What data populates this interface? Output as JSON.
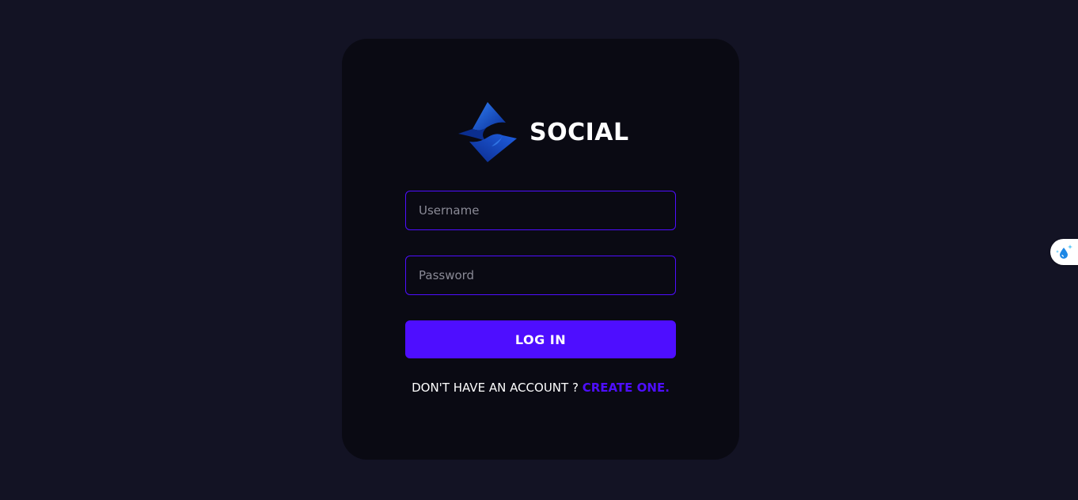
{
  "brand": {
    "name": "SOCIAL",
    "logo_icon": "diamond-s-logo-icon"
  },
  "form": {
    "username_placeholder": "Username",
    "username_value": "",
    "password_placeholder": "Password",
    "password_value": "",
    "login_label": "LOG IN",
    "register_prompt": "DON'T HAVE AN ACCOUNT ? ",
    "register_link": "CREATE ONE."
  },
  "extension": {
    "icon": "water-drop-sparkle-icon"
  },
  "colors": {
    "background": "#131324",
    "card": "#0a0a13",
    "accent": "#4e0eff",
    "text": "#ffffff",
    "placeholder": "#8a8a96"
  }
}
